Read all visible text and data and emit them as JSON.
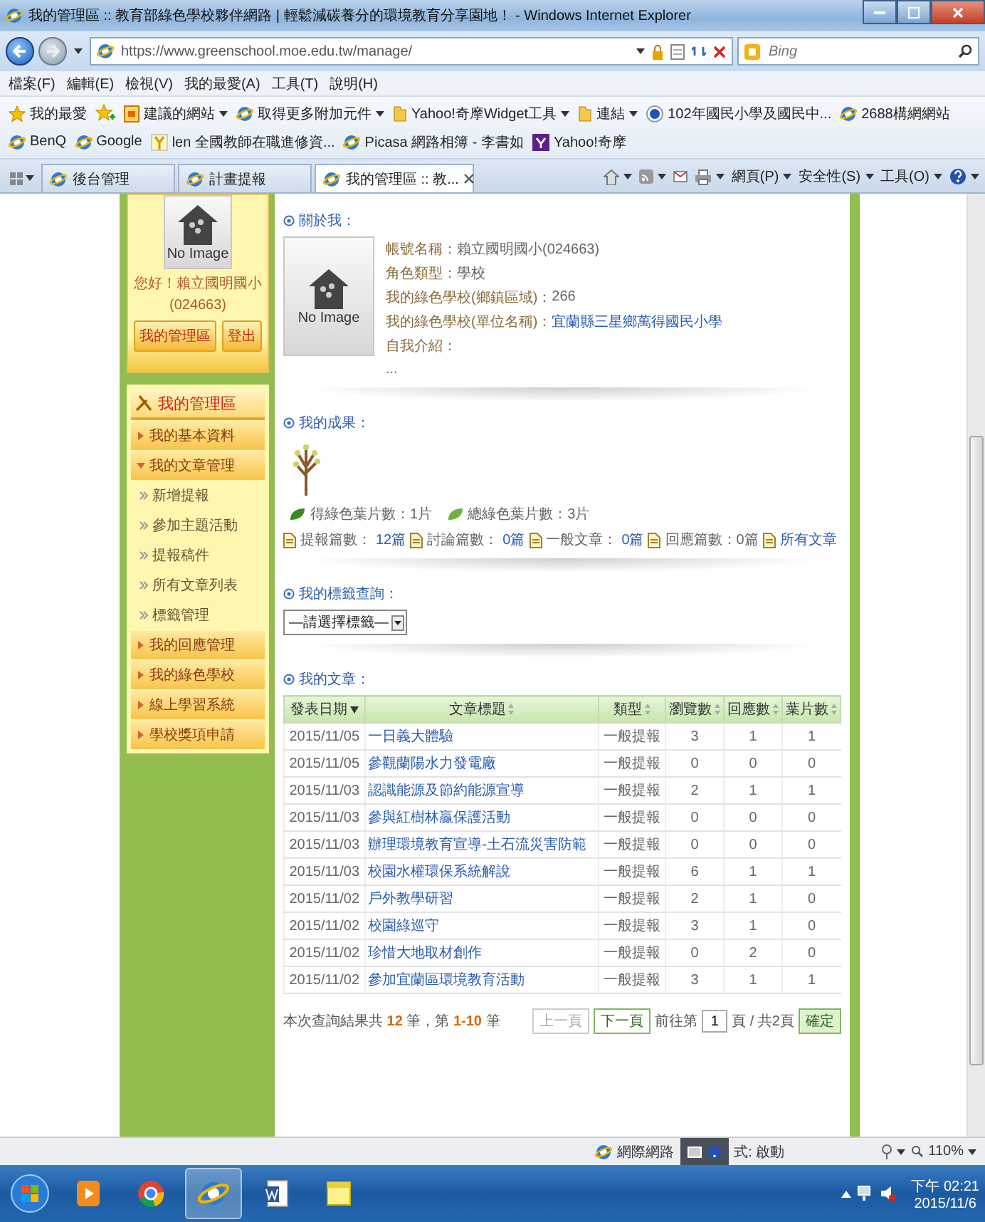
{
  "window": {
    "title": "我的管理區 :: 教育部綠色學校夥伴網路 | 輕鬆減碳養分的環境教育分享園地！ - Windows Internet Explorer"
  },
  "address_bar": {
    "url": "https://www.greenschool.moe.edu.tw/manage/",
    "search_placeholder": "Bing"
  },
  "menu_bar": [
    "檔案(F)",
    "編輯(E)",
    "檢視(V)",
    "我的最愛(A)",
    "工具(T)",
    "說明(H)"
  ],
  "favorites_bar": [
    {
      "label": "我的最愛",
      "kind": "star",
      "dropdown": false
    },
    {
      "label": "建議的網站",
      "kind": "suggest",
      "dropdown": true
    },
    {
      "label": "取得更多附加元件",
      "kind": "site",
      "dropdown": true
    },
    {
      "label": "Yahoo!奇摩Widget工具",
      "kind": "folder",
      "dropdown": true
    },
    {
      "label": "連結",
      "kind": "folder",
      "dropdown": true
    },
    {
      "label": "102年國民小學及國民中...",
      "kind": "globe",
      "dropdown": false
    },
    {
      "label": "2688構網網站",
      "kind": "site",
      "dropdown": false
    },
    {
      "label": "BenQ",
      "kind": "site",
      "dropdown": false
    },
    {
      "label": "Google",
      "kind": "site",
      "dropdown": false
    },
    {
      "label": "len 全國教師在職進修資...",
      "kind": "fork",
      "dropdown": false
    },
    {
      "label": "Picasa 網路相簿 - 李書如",
      "kind": "site",
      "dropdown": false
    },
    {
      "label": "Yahoo!奇摩",
      "kind": "square",
      "dropdown": false
    }
  ],
  "tabs": [
    {
      "label": "後台管理",
      "selected": false
    },
    {
      "label": "計畫提報",
      "selected": false
    },
    {
      "label": "我的管理區 :: 教...",
      "selected": true
    }
  ],
  "command_bar": [
    "網頁(P)",
    "安全性(S)",
    "工具(O)"
  ],
  "sidebar": {
    "profile": {
      "image_text": "No Image",
      "greeting": "您好！賴立國明國小",
      "account_code": "(024663)",
      "buttons": [
        "我的管理區",
        "登出"
      ]
    },
    "menu": {
      "title": "我的管理區",
      "items": [
        {
          "label": "我的基本資料",
          "expanded": false
        },
        {
          "label": "我的文章管理",
          "expanded": true,
          "children": [
            {
              "label": "新增提報"
            },
            {
              "label": "參加主題活動"
            },
            {
              "label": "提報稿件"
            },
            {
              "label": "所有文章列表"
            },
            {
              "label": "標籤管理"
            }
          ]
        },
        {
          "label": "我的回應管理",
          "expanded": false
        },
        {
          "label": "我的綠色學校",
          "expanded": false
        },
        {
          "label": "線上學習系統",
          "expanded": false
        },
        {
          "label": "學校獎項申請",
          "expanded": false
        }
      ]
    }
  },
  "about": {
    "heading": "關於我：",
    "image_text": "No Image",
    "fields": [
      {
        "label": "帳號名稱：",
        "value": "賴立國明國小(024663)",
        "kind": "text"
      },
      {
        "label": "角色類型：",
        "value": "學校",
        "kind": "text"
      },
      {
        "label": "我的綠色學校(鄉鎮區域)：",
        "value": "266",
        "kind": "text"
      },
      {
        "label": "我的綠色學校(單位名稱)：",
        "value": "宜蘭縣三星鄉萬得國民小學",
        "kind": "link"
      },
      {
        "label": "自我介紹："
      }
    ],
    "bio": "..."
  },
  "achievements": {
    "heading": "我的成果：",
    "leaves": [
      {
        "text": "得綠色葉片數：1片",
        "color": "#3a8a1e"
      },
      {
        "text": "總綠色葉片數：3片",
        "color": "#6cb33e"
      }
    ],
    "stats": [
      {
        "label": "提報篇數：",
        "link": "12篇"
      },
      {
        "label": "討論篇數：",
        "link": "0篇"
      },
      {
        "label": "一般文章：",
        "link": "0篇"
      },
      {
        "label": "回應篇數：0篇"
      },
      {
        "link": "所有文章"
      }
    ]
  },
  "tag_search": {
    "heading": "我的標籤查詢：",
    "select": "—請選擇標籤—"
  },
  "articles": {
    "heading": "我的文章：",
    "columns": [
      {
        "label": "發表日期",
        "sorted": true
      },
      {
        "label": "文章標題",
        "sorted": false
      },
      {
        "label": "類型",
        "sorted": false
      },
      {
        "label": "瀏覽數",
        "sorted": false
      },
      {
        "label": "回應數",
        "sorted": false
      },
      {
        "label": "葉片數",
        "sorted": false
      }
    ],
    "rows": [
      {
        "date": "2015/11/05",
        "title": "一日義大體驗",
        "type": "一般提報",
        "views": "3",
        "replies": "1",
        "leaves": "1"
      },
      {
        "date": "2015/11/05",
        "title": "參觀蘭陽水力發電廠",
        "type": "一般提報",
        "views": "0",
        "replies": "0",
        "leaves": "0"
      },
      {
        "date": "2015/11/03",
        "title": "認識能源及節約能源宣導",
        "type": "一般提報",
        "views": "2",
        "replies": "1",
        "leaves": "1"
      },
      {
        "date": "2015/11/03",
        "title": "參與紅樹林贏保護活動",
        "type": "一般提報",
        "views": "0",
        "replies": "0",
        "leaves": "0"
      },
      {
        "date": "2015/11/03",
        "title": "辦理環境教育宣導-土石流災害防範",
        "type": "一般提報",
        "views": "0",
        "replies": "0",
        "leaves": "0"
      },
      {
        "date": "2015/11/03",
        "title": "校園水權環保系統解說",
        "type": "一般提報",
        "views": "6",
        "replies": "1",
        "leaves": "1"
      },
      {
        "date": "2015/11/02",
        "title": "戶外教學研習",
        "type": "一般提報",
        "views": "2",
        "replies": "1",
        "leaves": "0"
      },
      {
        "date": "2015/11/02",
        "title": "校園綠巡守",
        "type": "一般提報",
        "views": "3",
        "replies": "1",
        "leaves": "0"
      },
      {
        "date": "2015/11/02",
        "title": "珍惜大地取材創作",
        "type": "一般提報",
        "views": "0",
        "replies": "2",
        "leaves": "0"
      },
      {
        "date": "2015/11/02",
        "title": "參加宜蘭區環境教育活動",
        "type": "一般提報",
        "views": "3",
        "replies": "1",
        "leaves": "1"
      }
    ],
    "summary": "本次查詢結果共 **12** 筆，第 **1-10** 筆",
    "pager": {
      "prev": {
        "label": "上一頁",
        "disabled": true
      },
      "next": {
        "label": "下一頁",
        "disabled": false
      },
      "goto_prefix": "前往第",
      "page": "1",
      "goto_suffix": "頁 / 共2頁",
      "confirm": "確定"
    }
  },
  "status_bar": {
    "zone": "網際網路",
    "mode": "式: 啟動",
    "zoom": "110%"
  },
  "taskbar": {
    "time": "下午 02:21",
    "date": "2015/11/6"
  }
}
